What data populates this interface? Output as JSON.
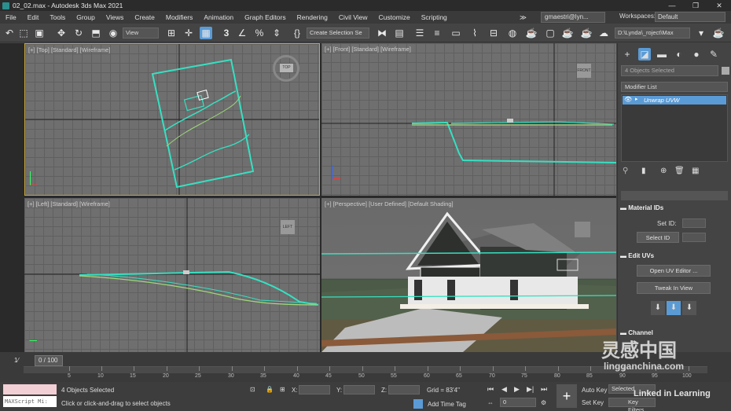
{
  "window": {
    "title": "02_02.max - Autodesk 3ds Max 2021",
    "min": "—",
    "max": "❐",
    "close": "✕"
  },
  "menu": {
    "items": [
      "File",
      "Edit",
      "Tools",
      "Group",
      "Views",
      "Create",
      "Modifiers",
      "Animation",
      "Graph Editors",
      "Rendering",
      "Civil View",
      "Customize",
      "Scripting"
    ],
    "overflow": "≫",
    "user": "gmaestri@lyn...",
    "workspaces_label": "Workspaces:",
    "workspace_value": "Default"
  },
  "toolbar": {
    "view_dropdown": "View",
    "selection_set": "Create Selection Se",
    "project_path": "D:\\Lynda\\_roject\\Max",
    "snap_label": "3",
    "percent_label": "%"
  },
  "viewports": {
    "top": {
      "label": "[+] [Top] [Standard] [Wireframe]",
      "cube": "TOP"
    },
    "front": {
      "label": "[+] [Front] [Standard] [Wireframe]",
      "cube": "FRONT"
    },
    "left": {
      "label": "[+] [Left] [Standard] [Wireframe]",
      "cube": "LEFT"
    },
    "persp": {
      "label": "[+] [Perspective] [User Defined] [Default Shading]"
    }
  },
  "command_panel": {
    "objects_selected": "4 Objects Selected",
    "modifier_list": "Modifier List",
    "stack_item": "Unwrap UVW",
    "material_ids": "Material IDs",
    "set_id_label": "Set ID:",
    "select_id": "Select ID",
    "edit_uvs": "Edit UVs",
    "open_uv_editor": "Open UV Editor ...",
    "tweak_in_view": "Tweak In View",
    "channel": "Channel"
  },
  "timeline": {
    "frame": "0 / 100",
    "ticks": [
      "5",
      "10",
      "15",
      "20",
      "25",
      "30",
      "35",
      "40",
      "45",
      "50",
      "55",
      "60",
      "65",
      "70",
      "75",
      "80",
      "85",
      "90",
      "95",
      "100"
    ]
  },
  "status": {
    "maxscript": "MAXScript Mi:",
    "objects_selected": "4 Objects Selected",
    "prompt": "Click or click-and-drag to select objects",
    "x_label": "X:",
    "y_label": "Y:",
    "z_label": "Z:",
    "grid": "Grid = 83'4\"",
    "add_time_tag": "Add Time Tag",
    "auto_key": "Auto Key",
    "selected": "Selected",
    "set_key": "Set Key",
    "key_filters": "Key Filters...",
    "frame_value": "0"
  },
  "watermark": {
    "brand": "Linked in Learning",
    "cn": "灵感中国",
    "url": "lingganchina.com"
  },
  "colors": {
    "accent": "#5b9bd5",
    "selection": "#36e0c2",
    "viewport_border": "#c9a63a"
  }
}
